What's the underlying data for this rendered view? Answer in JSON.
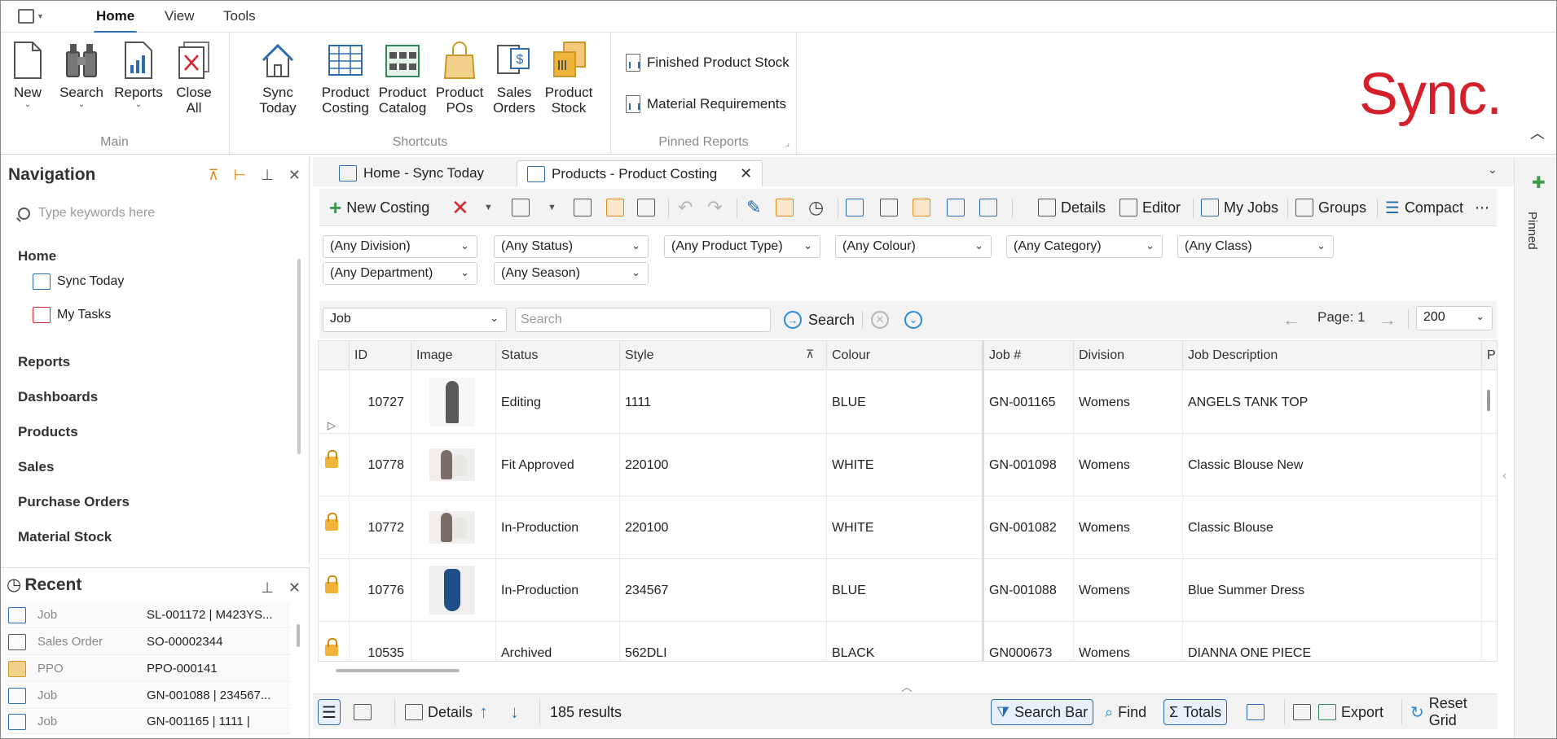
{
  "menu": {
    "tabs": [
      "Home",
      "View",
      "Tools"
    ]
  },
  "ribbon": {
    "main": {
      "label": "Main",
      "buttons": [
        {
          "label": "New",
          "icon": "new-document-icon"
        },
        {
          "label": "Search",
          "icon": "binoculars-icon"
        },
        {
          "label": "Reports",
          "icon": "report-chart-icon"
        },
        {
          "label": "Close",
          "label2": "All",
          "icon": "close-all-icon"
        }
      ]
    },
    "shortcuts": {
      "label": "Shortcuts",
      "buttons": [
        {
          "label": "Sync Today",
          "label2": "",
          "icon": "house-icon"
        },
        {
          "label": "Product",
          "label2": "Costing",
          "icon": "costing-grid-icon"
        },
        {
          "label": "Product",
          "label2": "Catalog",
          "icon": "catalog-icon"
        },
        {
          "label": "Product",
          "label2": "POs",
          "icon": "shopping-bag-icon"
        },
        {
          "label": "Sales",
          "label2": "Orders",
          "icon": "sales-order-icon"
        },
        {
          "label": "Product",
          "label2": "Stock",
          "icon": "stock-boxes-icon"
        }
      ]
    },
    "pinned_reports": {
      "label": "Pinned Reports",
      "items": [
        "Finished Product Stock",
        "Material Requirements"
      ]
    },
    "logo_text": "Sync."
  },
  "navigation": {
    "title": "Navigation",
    "search_placeholder": "Type keywords here",
    "sections": {
      "home": "Home",
      "home_items": [
        "Sync Today",
        "My Tasks"
      ],
      "others": [
        "Reports",
        "Dashboards",
        "Products",
        "Sales",
        "Purchase Orders",
        "Material Stock"
      ]
    }
  },
  "recent": {
    "title": "Recent",
    "items": [
      {
        "type": "Job",
        "value": "SL-001172 | M423YS..."
      },
      {
        "type": "Sales Order",
        "value": "SO-00002344"
      },
      {
        "type": "PPO",
        "value": "PPO-000141"
      },
      {
        "type": "Job",
        "value": "GN-001088 | 234567..."
      },
      {
        "type": "Job",
        "value": "GN-001165 | 1111 |"
      }
    ]
  },
  "doc_tabs": [
    {
      "label": "Home - Sync Today"
    },
    {
      "label": "Products - Product Costing"
    }
  ],
  "toolbar": {
    "new_costing": "New Costing",
    "details": "Details",
    "editor": "Editor",
    "my_jobs": "My Jobs",
    "groups": "Groups",
    "compact": "Compact",
    "more": "⋯"
  },
  "filters": {
    "row1": [
      "(Any Division)",
      "(Any Status)",
      "(Any Product Type)",
      "(Any Colour)",
      "(Any Category)",
      "(Any Class)"
    ],
    "row2": [
      "(Any Department)",
      "(Any Season)"
    ]
  },
  "search": {
    "field": "Job",
    "placeholder": "Search",
    "button": "Search",
    "page": "Page: 1",
    "page_size": "200"
  },
  "grid": {
    "columns": [
      "ID",
      "Image",
      "Status",
      "Style",
      "Colour",
      "Job #",
      "Division",
      "Job Description",
      "Pı"
    ],
    "rows": [
      {
        "id": "10727",
        "status": "Editing",
        "style": "1111",
        "colour": "BLUE",
        "job": "GN-001165",
        "division": "Womens",
        "desc": "ANGELS TANK TOP",
        "locked": false,
        "image": "tank-top"
      },
      {
        "id": "10778",
        "status": "Fit Approved",
        "style": "220100",
        "colour": "WHITE",
        "job": "GN-001098",
        "division": "Womens",
        "desc": "Classic Blouse New",
        "locked": true,
        "image": "blouse"
      },
      {
        "id": "10772",
        "status": "In-Production",
        "style": "220100",
        "colour": "WHITE",
        "job": "GN-001082",
        "division": "Womens",
        "desc": "Classic Blouse",
        "locked": true,
        "image": "blouse"
      },
      {
        "id": "10776",
        "status": "In-Production",
        "style": "234567",
        "colour": "BLUE",
        "job": "GN-001088",
        "division": "Womens",
        "desc": "Blue Summer Dress",
        "locked": true,
        "image": "dress"
      },
      {
        "id": "10535",
        "status": "Archived",
        "style": "562DLI",
        "colour": "BLACK",
        "job": "GN000673",
        "division": "Womens",
        "desc": "DIANNA ONE PIECE",
        "locked": true,
        "image": ""
      }
    ]
  },
  "statusbar": {
    "details": "Details",
    "results": "185 results",
    "search_bar": "Search Bar",
    "find": "Find",
    "totals": "Totals",
    "export": "Export",
    "reset_grid": "Reset Grid"
  },
  "pinned_side_label": "Pinned",
  "colors": {
    "accent": "#2b6cb0",
    "logo": "#d4202a",
    "lock": "#f0b43a"
  }
}
